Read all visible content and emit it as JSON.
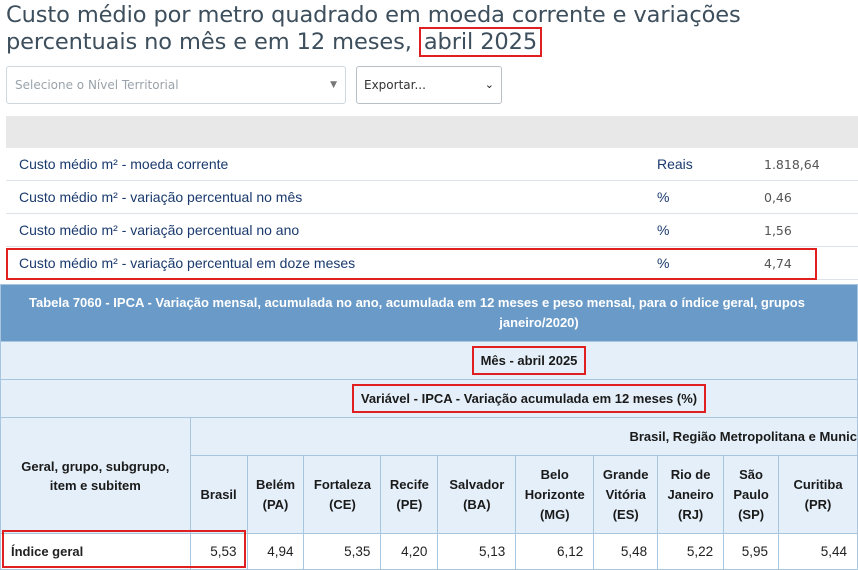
{
  "title": {
    "main": "Custo médio por metro quadrado em moeda corrente e variações percentuais no mês e em 12 meses,",
    "period": "abril 2025"
  },
  "controls": {
    "territory_placeholder": "Selecione o Nível Territorial",
    "export_label": "Exportar..."
  },
  "indicators": [
    {
      "label": "Custo médio m² - moeda corrente",
      "unit": "Reais",
      "value": "1.818,64"
    },
    {
      "label": "Custo médio m² - variação percentual no mês",
      "unit": "%",
      "value": "0,46"
    },
    {
      "label": "Custo médio m² - variação percentual no ano",
      "unit": "%",
      "value": "1,56"
    },
    {
      "label": "Custo médio m² - variação percentual em doze meses",
      "unit": "%",
      "value": "4,74"
    }
  ],
  "table": {
    "caption_line1": "Tabela 7060 - IPCA - Variação mensal, acumulada no ano, acumulada em 12 meses e peso mensal, para o índice geral, grupos",
    "caption_line2": "janeiro/2020)",
    "month_label": "Mês - abril 2025",
    "variable_label": "Variável - IPCA - Variação acumulada em 12 meses (%)",
    "row_header": "Geral, grupo, subgrupo, item e subitem",
    "region_header": "Brasil, Região Metropolitana e Munic",
    "columns": [
      "Brasil",
      "Belém (PA)",
      "Fortaleza (CE)",
      "Recife (PE)",
      "Salvador (BA)",
      "Belo Horizonte (MG)",
      "Grande Vitória (ES)",
      "Rio de Janeiro (RJ)",
      "São Paulo (SP)",
      "Curitiba (PR)"
    ],
    "rows": [
      {
        "label": "Índice geral",
        "values": [
          "5,53",
          "4,94",
          "5,35",
          "4,20",
          "5,13",
          "6,12",
          "5,48",
          "5,22",
          "5,95",
          "5,44"
        ]
      }
    ]
  }
}
